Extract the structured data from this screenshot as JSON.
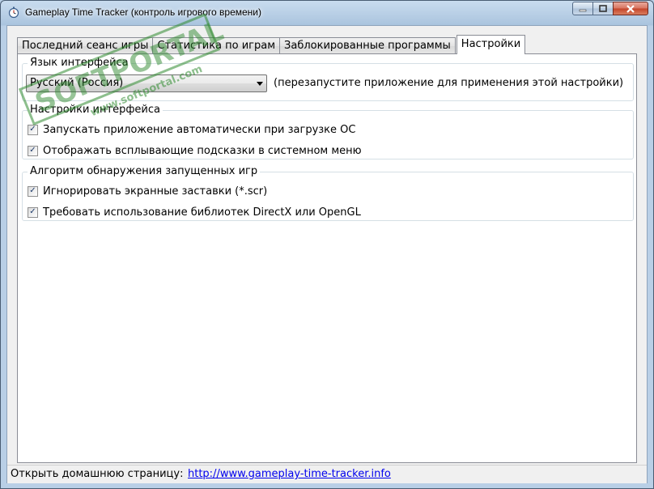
{
  "window": {
    "title": "Gameplay Time Tracker (контроль игрового времени)"
  },
  "tabs": [
    {
      "label": "Последний сеанс игры"
    },
    {
      "label": "Статистика по играм"
    },
    {
      "label": "Заблокированные программы"
    },
    {
      "label": "Настройки"
    }
  ],
  "language_group": {
    "legend": "Язык интерфейса",
    "selected": "Русский (Россия)",
    "hint": "(перезапустите приложение для применения этой настройки)"
  },
  "interface_group": {
    "legend": "Настройки интерфейса",
    "options": [
      {
        "label": "Запускать приложение автоматически при загрузке ОС",
        "checked": true
      },
      {
        "label": "Отображать всплывающие подсказки в системном меню",
        "checked": true
      }
    ]
  },
  "detection_group": {
    "legend": "Алгоритм обнаружения запущенных игр",
    "options": [
      {
        "label": "Игнорировать экранные заставки (*.scr)",
        "checked": true
      },
      {
        "label": "Требовать использование библиотек DirectX или OpenGL",
        "checked": true
      }
    ]
  },
  "status": {
    "label": "Открыть домашнюю страницу:",
    "link": "http://www.gameplay-time-tracker.info"
  },
  "watermark": {
    "brand": "SOFTPORTAL",
    "url": "www.softportal.com"
  },
  "check_mark": "✓"
}
